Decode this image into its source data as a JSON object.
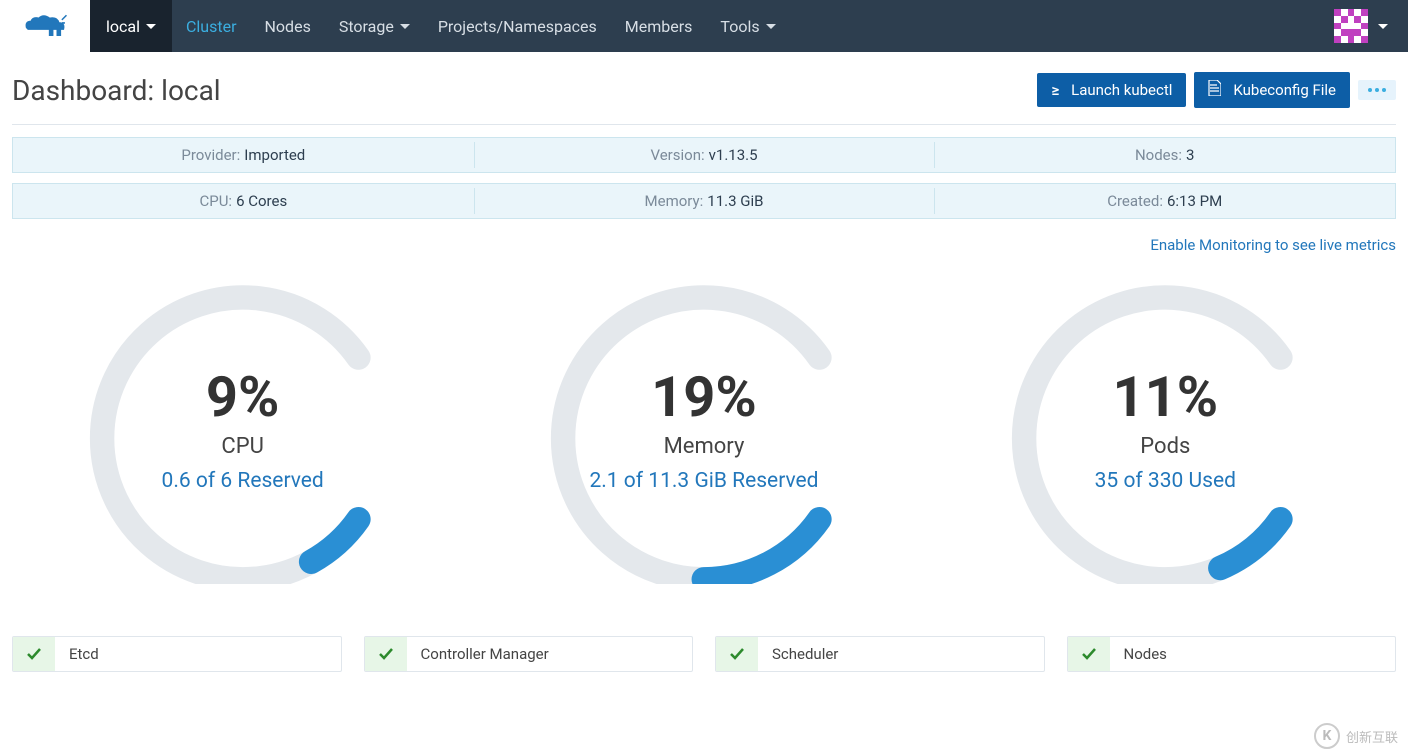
{
  "nav": {
    "local": "local",
    "items": [
      "Cluster",
      "Nodes",
      "Storage",
      "Projects/Namespaces",
      "Members",
      "Tools"
    ],
    "dropdown_indices": [
      2,
      5
    ]
  },
  "page_title": "Dashboard: local",
  "actions": {
    "launch_kubectl": "Launch kubectl",
    "kubeconfig": "Kubeconfig File"
  },
  "info_rows": [
    [
      {
        "label": "Provider:",
        "value": "Imported"
      },
      {
        "label": "Version:",
        "value": "v1.13.5"
      },
      {
        "label": "Nodes:",
        "value": "3"
      }
    ],
    [
      {
        "label": "CPU:",
        "value": "6 Cores"
      },
      {
        "label": "Memory:",
        "value": "11.3 GiB"
      },
      {
        "label": "Created:",
        "value": "6:13 PM"
      }
    ]
  ],
  "metrics_link": "Enable Monitoring to see live metrics",
  "chart_data": {
    "type": "gauge",
    "gauges": [
      {
        "label": "CPU",
        "percent": 9,
        "subtitle": "0.6 of 6 Reserved"
      },
      {
        "label": "Memory",
        "percent": 19,
        "subtitle": "2.1 of 11.3 GiB Reserved"
      },
      {
        "label": "Pods",
        "percent": 11,
        "subtitle": "35 of 330 Used"
      }
    ]
  },
  "components": [
    "Etcd",
    "Controller Manager",
    "Scheduler",
    "Nodes"
  ],
  "watermark": "创新互联"
}
